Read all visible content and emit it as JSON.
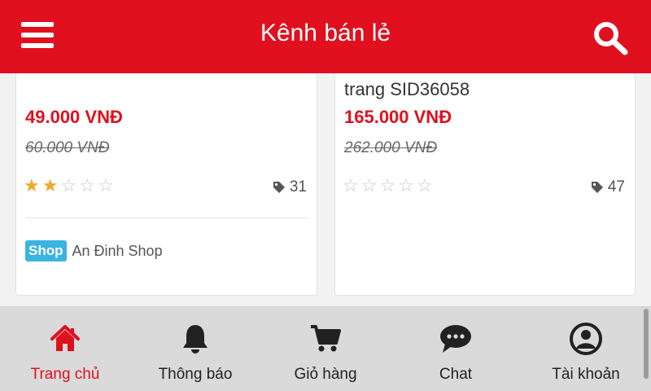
{
  "header": {
    "title": "Kênh bán lẻ",
    "menu_icon": "hamburger-menu-icon",
    "search_icon": "search-icon"
  },
  "colors": {
    "brand_red": "#e0101e",
    "star": "#f0a830",
    "shop_badge": "#3ab3e0"
  },
  "products": [
    {
      "name": "",
      "price": "49.000 VNĐ",
      "old_price": "60.000 VNĐ",
      "rating": 2,
      "max_rating": 5,
      "tag_count": "31",
      "shop_badge": "Shop",
      "shop_name": "An Đinh Shop"
    },
    {
      "name": "trang SID36058",
      "price": "165.000 VNĐ",
      "old_price": "262.000 VNĐ",
      "rating": 0,
      "max_rating": 5,
      "tag_count": "47"
    }
  ],
  "bottom_nav": [
    {
      "label": "Trang chủ",
      "icon": "home-icon",
      "active": true
    },
    {
      "label": "Thông báo",
      "icon": "bell-icon",
      "active": false
    },
    {
      "label": "Giỏ hàng",
      "icon": "cart-icon",
      "active": false
    },
    {
      "label": "Chat",
      "icon": "chat-icon",
      "active": false
    },
    {
      "label": "Tài khoản",
      "icon": "account-icon",
      "active": false
    }
  ]
}
